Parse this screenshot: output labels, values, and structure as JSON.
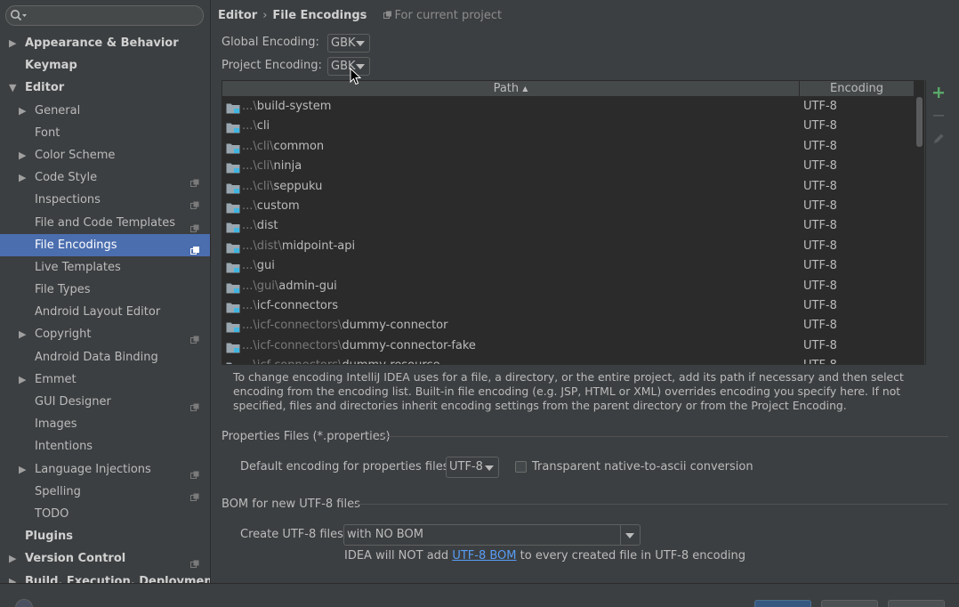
{
  "search": {
    "placeholder": ""
  },
  "sidebar": {
    "items": [
      {
        "label": "Appearance & Behavior",
        "level": 0,
        "arrow": "▶",
        "bold": true,
        "project_icon": false
      },
      {
        "label": "Keymap",
        "level": 0,
        "arrow": "",
        "bold": true,
        "project_icon": false
      },
      {
        "label": "Editor",
        "level": 0,
        "arrow": "▼",
        "bold": true,
        "project_icon": false
      },
      {
        "label": "General",
        "level": 1,
        "arrow": "▶",
        "bold": false,
        "project_icon": false
      },
      {
        "label": "Font",
        "level": 1,
        "arrow": "",
        "bold": false,
        "project_icon": false
      },
      {
        "label": "Color Scheme",
        "level": 1,
        "arrow": "▶",
        "bold": false,
        "project_icon": false
      },
      {
        "label": "Code Style",
        "level": 1,
        "arrow": "▶",
        "bold": false,
        "project_icon": true
      },
      {
        "label": "Inspections",
        "level": 1,
        "arrow": "",
        "bold": false,
        "project_icon": true
      },
      {
        "label": "File and Code Templates",
        "level": 1,
        "arrow": "",
        "bold": false,
        "project_icon": true
      },
      {
        "label": "File Encodings",
        "level": 1,
        "arrow": "",
        "bold": false,
        "project_icon": true,
        "selected": true
      },
      {
        "label": "Live Templates",
        "level": 1,
        "arrow": "",
        "bold": false,
        "project_icon": false
      },
      {
        "label": "File Types",
        "level": 1,
        "arrow": "",
        "bold": false,
        "project_icon": false
      },
      {
        "label": "Android Layout Editor",
        "level": 1,
        "arrow": "",
        "bold": false,
        "project_icon": false
      },
      {
        "label": "Copyright",
        "level": 1,
        "arrow": "▶",
        "bold": false,
        "project_icon": true
      },
      {
        "label": "Android Data Binding",
        "level": 1,
        "arrow": "",
        "bold": false,
        "project_icon": false
      },
      {
        "label": "Emmet",
        "level": 1,
        "arrow": "▶",
        "bold": false,
        "project_icon": false
      },
      {
        "label": "GUI Designer",
        "level": 1,
        "arrow": "",
        "bold": false,
        "project_icon": true
      },
      {
        "label": "Images",
        "level": 1,
        "arrow": "",
        "bold": false,
        "project_icon": false
      },
      {
        "label": "Intentions",
        "level": 1,
        "arrow": "",
        "bold": false,
        "project_icon": false
      },
      {
        "label": "Language Injections",
        "level": 1,
        "arrow": "▶",
        "bold": false,
        "project_icon": true
      },
      {
        "label": "Spelling",
        "level": 1,
        "arrow": "",
        "bold": false,
        "project_icon": true
      },
      {
        "label": "TODO",
        "level": 1,
        "arrow": "",
        "bold": false,
        "project_icon": false
      },
      {
        "label": "Plugins",
        "level": 0,
        "arrow": "",
        "bold": true,
        "project_icon": false
      },
      {
        "label": "Version Control",
        "level": 0,
        "arrow": "▶",
        "bold": true,
        "project_icon": true
      },
      {
        "label": "Build, Execution, Deployment",
        "level": 0,
        "arrow": "▶",
        "bold": true,
        "project_icon": false
      }
    ]
  },
  "header": {
    "crumb_parent": "Editor",
    "crumb_separator": "›",
    "crumb_current": "File Encodings",
    "scope": "For current project"
  },
  "global_encoding": {
    "label": "Global Encoding:",
    "value": "GBK"
  },
  "project_encoding": {
    "label": "Project Encoding:",
    "value": "GBK"
  },
  "table": {
    "col_path": "Path",
    "col_sort_indicator": "▲",
    "col_encoding": "Encoding",
    "rows": [
      {
        "prefix": "...\\",
        "name": "build-system",
        "encoding": "UTF-8"
      },
      {
        "prefix": "...\\",
        "name": "cli",
        "encoding": "UTF-8"
      },
      {
        "prefix": "...\\cli\\",
        "name": "common",
        "encoding": "UTF-8"
      },
      {
        "prefix": "...\\cli\\",
        "name": "ninja",
        "encoding": "UTF-8"
      },
      {
        "prefix": "...\\cli\\",
        "name": "seppuku",
        "encoding": "UTF-8"
      },
      {
        "prefix": "...\\",
        "name": "custom",
        "encoding": "UTF-8"
      },
      {
        "prefix": "...\\",
        "name": "dist",
        "encoding": "UTF-8"
      },
      {
        "prefix": "...\\dist\\",
        "name": "midpoint-api",
        "encoding": "UTF-8"
      },
      {
        "prefix": "...\\",
        "name": "gui",
        "encoding": "UTF-8"
      },
      {
        "prefix": "...\\gui\\",
        "name": "admin-gui",
        "encoding": "UTF-8"
      },
      {
        "prefix": "...\\",
        "name": "icf-connectors",
        "encoding": "UTF-8"
      },
      {
        "prefix": "...\\icf-connectors\\",
        "name": "dummy-connector",
        "encoding": "UTF-8"
      },
      {
        "prefix": "...\\icf-connectors\\",
        "name": "dummy-connector-fake",
        "encoding": "UTF-8"
      },
      {
        "prefix": "...\\icf-connectors\\",
        "name": "dummy-resource",
        "encoding": "UTF-8"
      }
    ]
  },
  "help_text": "To change encoding IntelliJ IDEA uses for a file, a directory, or the entire project, add its path if necessary and then select encoding from the encoding list. Built-in file encoding (e.g. JSP, HTML or XML) overrides encoding you specify here. If not specified, files and directories inherit encoding settings from the parent directory or from the Project Encoding.",
  "properties": {
    "section_title": "Properties Files (*.properties)",
    "default_label": "Default encoding for properties files:",
    "default_value": "UTF-8",
    "transparent_label": "Transparent native-to-ascii conversion",
    "transparent_checked": false
  },
  "bom": {
    "section_title": "BOM for new UTF-8 files",
    "create_label": "Create UTF-8 files:",
    "create_value": "with NO BOM",
    "note_before": "IDEA will NOT add ",
    "note_link": "UTF-8 BOM",
    "note_after": " to every created file in UTF-8 encoding"
  },
  "colors": {
    "background": "#3c3f41",
    "selection": "#4b6eaf",
    "table_bg": "#2b2b2b",
    "link": "#589df6",
    "add_icon": "#59a869",
    "folder_icon": "#9aa7b0"
  }
}
